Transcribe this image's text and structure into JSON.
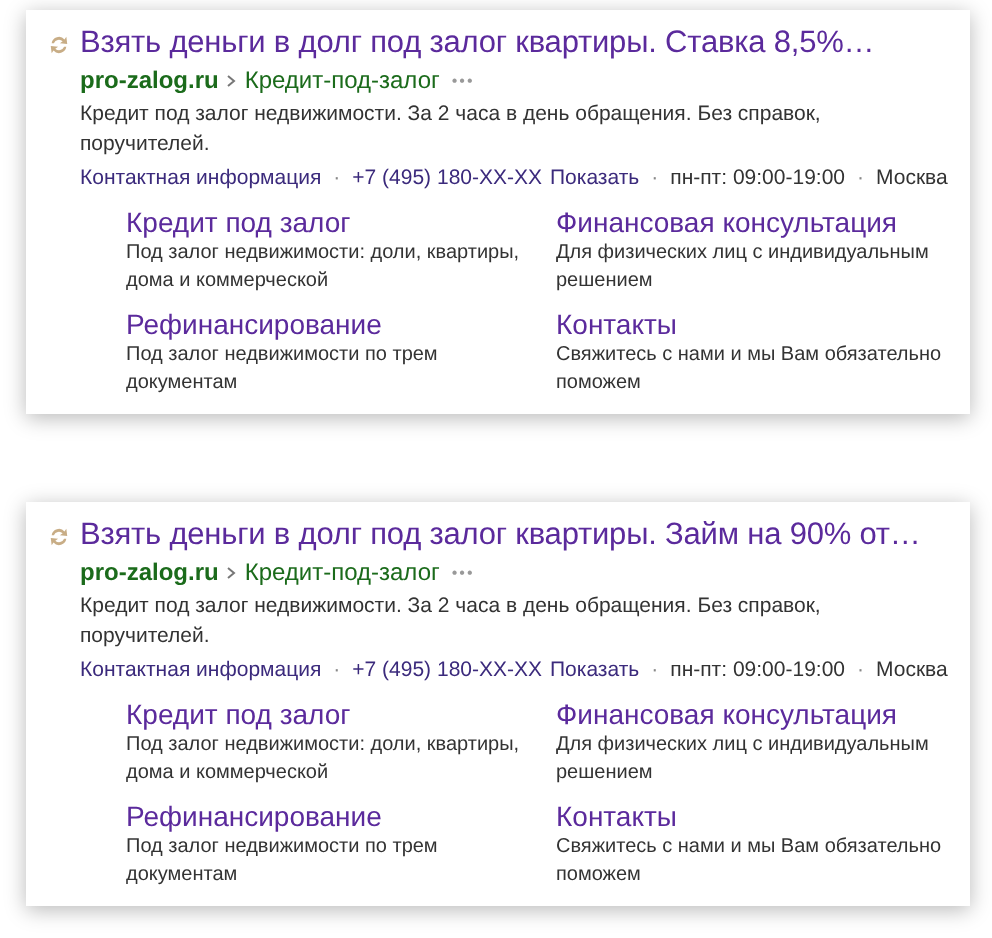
{
  "ads": [
    {
      "title": "Взять деньги в долг под залог квартиры. Ставка 8,5%…",
      "domain": "pro-zalog.ru",
      "path": "Кредит-под-залог",
      "more": "•••",
      "description": "Кредит под залог недвижимости. За 2 часа в день обращения. Без справок, поручителей.",
      "contacts": [
        {
          "kind": "link",
          "text": "Контактная информация"
        },
        {
          "kind": "phone",
          "text": "+7 (495) 180-XX-XX",
          "action": "Показать"
        },
        {
          "kind": "text",
          "text": "пн-пт: 09:00-19:00"
        },
        {
          "kind": "text",
          "text": "Москва"
        }
      ],
      "separator": "·",
      "sitelinks": [
        {
          "title": "Кредит под залог",
          "text": "Под залог недвижимости: доли, квартиры, дома и коммерческой"
        },
        {
          "title": "Финансовая консультация",
          "text": "Для физических лиц с индивидуальным решением"
        },
        {
          "title": "Рефинансирование",
          "text": "Под залог недвижимости по трем документам"
        },
        {
          "title": "Контакты",
          "text": "Свяжитесь с нами и мы Вам обязательно поможем"
        }
      ]
    },
    {
      "title": "Взять деньги в долг под залог квартиры. Займ на 90% от…",
      "domain": "pro-zalog.ru",
      "path": "Кредит-под-залог",
      "more": "•••",
      "description": "Кредит под залог недвижимости. За 2 часа в день обращения. Без справок, поручителей.",
      "contacts": [
        {
          "kind": "link",
          "text": "Контактная информация"
        },
        {
          "kind": "phone",
          "text": "+7 (495) 180-XX-XX",
          "action": "Показать"
        },
        {
          "kind": "text",
          "text": "пн-пт: 09:00-19:00"
        },
        {
          "kind": "text",
          "text": "Москва"
        }
      ],
      "separator": "·",
      "sitelinks": [
        {
          "title": "Кредит под залог",
          "text": "Под залог недвижимости: доли, квартиры, дома и коммерческой"
        },
        {
          "title": "Финансовая консультация",
          "text": "Для физических лиц с индивидуальным решением"
        },
        {
          "title": "Рефинансирование",
          "text": "Под залог недвижимости по трем документам"
        },
        {
          "title": "Контакты",
          "text": "Свяжитесь с нами и мы Вам обязательно поможем"
        }
      ]
    }
  ]
}
